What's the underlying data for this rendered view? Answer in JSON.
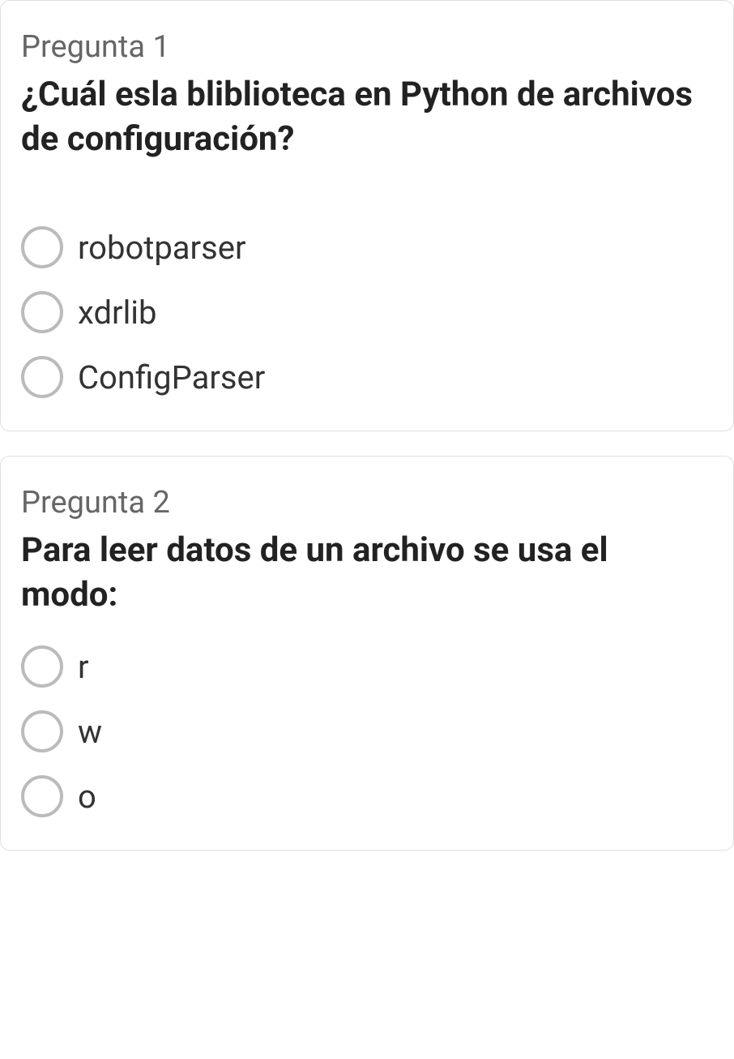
{
  "questions": [
    {
      "number": "Pregunta 1",
      "text": "¿Cuál esla bliblioteca en Python de archivos de configuración?",
      "options": [
        "robotparser",
        "xdrlib",
        "ConfigParser"
      ]
    },
    {
      "number": "Pregunta 2",
      "text": "Para leer datos de un archivo se usa el modo:",
      "options": [
        "r",
        "w",
        "o"
      ]
    }
  ]
}
